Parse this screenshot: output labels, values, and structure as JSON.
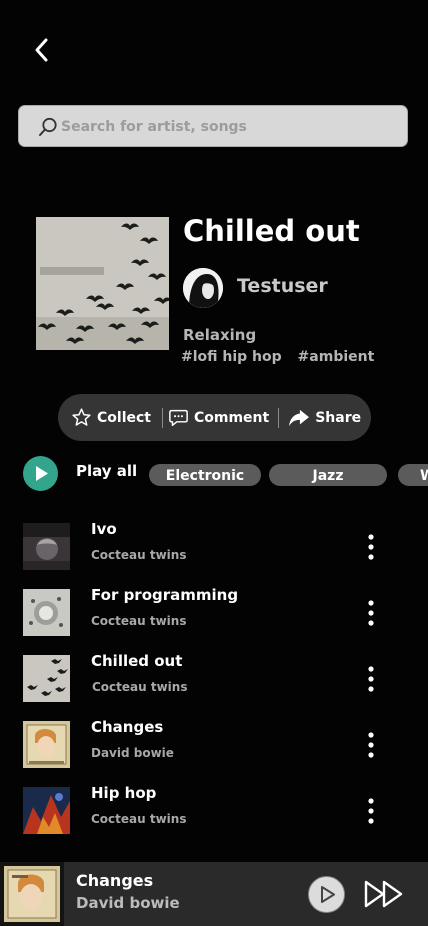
{
  "search": {
    "placeholder": "Search for artist, songs",
    "value": ""
  },
  "playlist": {
    "title": "Chilled out",
    "owner": "Testuser",
    "mood": "Relaxing",
    "tags": [
      "#lofi hip hop",
      "#ambient"
    ]
  },
  "actions": {
    "collect": "Collect",
    "comment": "Comment",
    "share": "Share"
  },
  "play_all_label": "Play all",
  "genres": [
    "Electronic",
    "Jazz",
    "W"
  ],
  "tracks": [
    {
      "title": "Ivo",
      "artist": "Cocteau twins"
    },
    {
      "title": "For programming",
      "artist": "Cocteau twins"
    },
    {
      "title": "Chilled out",
      "artist": "Cocteau twins"
    },
    {
      "title": "Changes",
      "artist": "David bowie"
    },
    {
      "title": "Hip hop",
      "artist": "Cocteau twins"
    }
  ],
  "now_playing": {
    "title": "Changes",
    "artist": "David bowie"
  },
  "colors": {
    "background": "#020302",
    "accent": "#33a58c",
    "chip": "#5b5b5b",
    "action_bar": "#353535"
  }
}
